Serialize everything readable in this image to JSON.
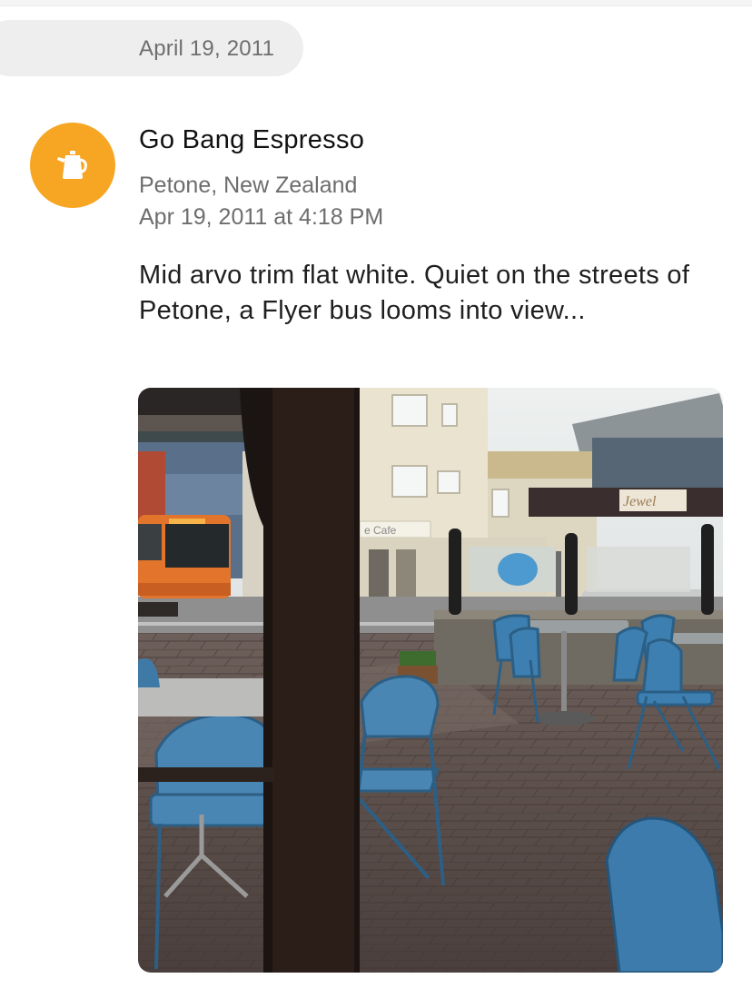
{
  "date_header": {
    "label": "April 19, 2011"
  },
  "checkin": {
    "venue_icon": "coffee-pot-icon",
    "venue_icon_color": "#f6a623",
    "venue_name": "Go Bang Espresso",
    "location": "Petone, New Zealand",
    "timestamp": "Apr 19, 2011 at 4:18 PM",
    "shout": "Mid arvo trim flat white. Quiet on the streets of Petone, a Flyer bus looms into view...",
    "photo": {
      "description_icon": "checkin-photo",
      "signs": {
        "cafe": "e Cafe",
        "shop": "Jewel"
      }
    }
  }
}
